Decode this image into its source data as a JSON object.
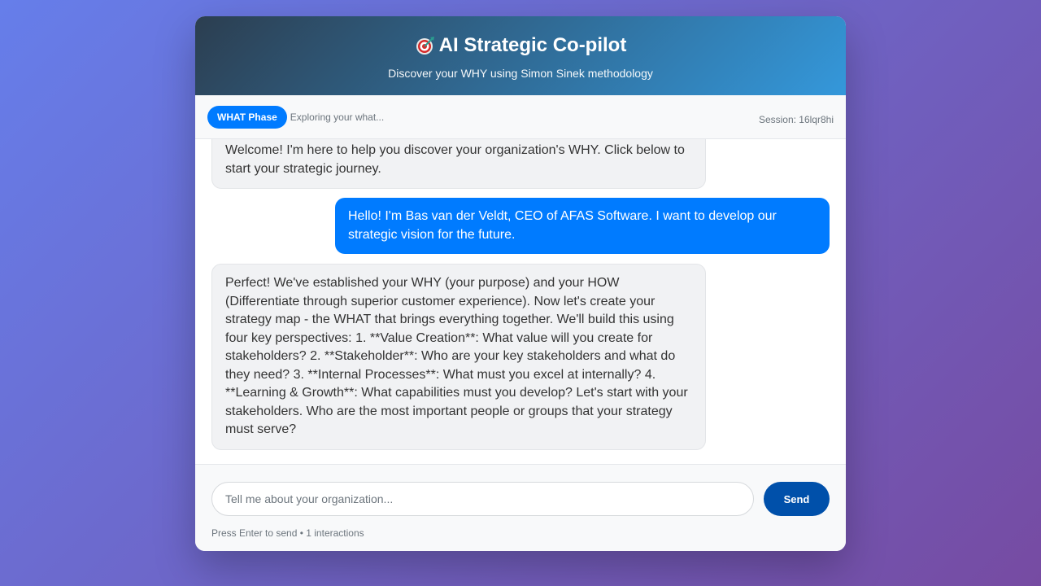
{
  "header": {
    "icon": "target-icon",
    "title": "AI Strategic Co-pilot",
    "subtitle": "Discover your WHY using Simon Sinek methodology"
  },
  "phase": {
    "badge": "WHAT Phase",
    "description": "Exploring your what...",
    "session": "Session: 16lqr8hi"
  },
  "messages": [
    {
      "role": "assistant",
      "text": "Welcome! I'm here to help you discover your organization's WHY. Click below to start your strategic journey."
    },
    {
      "role": "user",
      "text": "Hello! I'm Bas van der Veldt, CEO of AFAS Software. I want to develop our strategic vision for the future."
    },
    {
      "role": "assistant",
      "text": "Perfect! We've established your WHY (your purpose) and your HOW (Differentiate through superior customer experience). Now let's create your strategy map - the WHAT that brings everything together. We'll build this using four key perspectives: 1. **Value Creation**: What value will you create for stakeholders? 2. **Stakeholder**: Who are your key stakeholders and what do they need? 3. **Internal Processes**: What must you excel at internally? 4. **Learning & Growth**: What capabilities must you develop? Let's start with your stakeholders. Who are the most important people or groups that your strategy must serve?"
    }
  ],
  "composer": {
    "placeholder": "Tell me about your organization...",
    "value": "",
    "send_label": "Send",
    "hint": "Press Enter to send • 1 interactions"
  },
  "colors": {
    "accent": "#007bff",
    "send_button": "#0050aa",
    "header_start": "#2c3e50",
    "header_end": "#3498db"
  }
}
